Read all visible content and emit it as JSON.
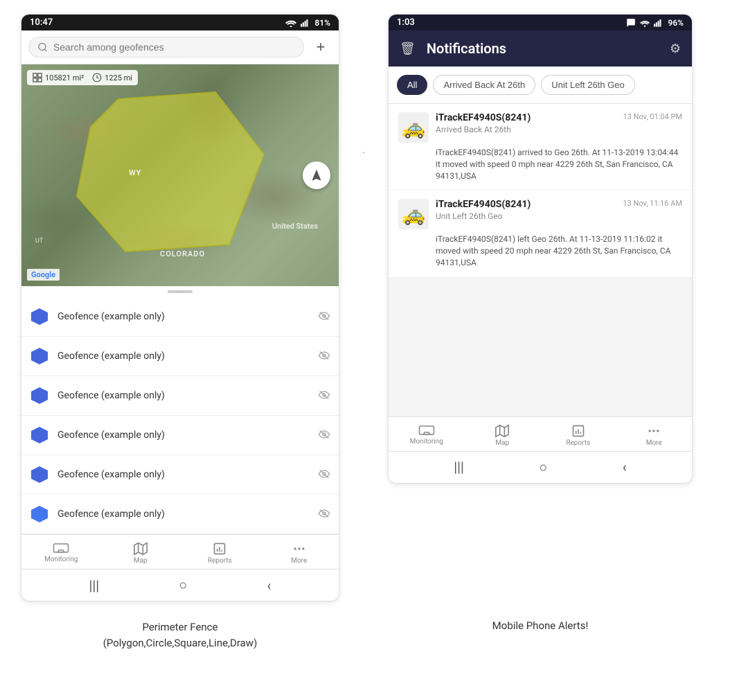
{
  "left_phone": {
    "status_bar": {
      "time": "10:47",
      "signal": "WiFi",
      "battery": "81%"
    },
    "search": {
      "placeholder": "Search among geofences"
    },
    "map": {
      "stat1": "105821 mi²",
      "stat2": "1225 mi",
      "labels": {
        "wy": "WY",
        "us": "United States",
        "co": "COLORADO",
        "ut": "UT"
      },
      "google": "Google"
    },
    "geo_items": [
      "Geofence (example only)",
      "Geofence (example only)",
      "Geofence (example only)",
      "Geofence (example only)",
      "Geofence (example only)",
      "Geofence (example only)"
    ],
    "bottom_nav": {
      "items": [
        "Monitoring",
        "Map",
        "Reports",
        "More"
      ]
    }
  },
  "right_phone": {
    "status_bar": {
      "time": "1:03",
      "battery": "96%"
    },
    "header": {
      "title": "Notifications",
      "delete_icon": "🗑",
      "settings_icon": "⚙"
    },
    "filter_tabs": [
      "All",
      "Arrived Back At 26th",
      "Unit Left 26th Geo"
    ],
    "notifications": [
      {
        "name": "iTrackEF4940S(8241)",
        "subtitle": "Arrived Back At 26th",
        "time": "13 Nov, 01:04 PM",
        "body": "iTrackEF4940S(8241) arrived to Geo 26th.   At 11-13-2019 13:04:44 it moved with speed 0 mph near 4229 26th St, San Francisco, CA 94131,USA"
      },
      {
        "name": "iTrackEF4940S(8241)",
        "subtitle": "Unit Left 26th Geo",
        "time": "13 Nov, 11:16 AM",
        "body": "iTrackEF4940S(8241) left Geo 26th.   At 11-13-2019 11:16:02 it moved with speed 20 mph near 4229 26th St, San Francisco, CA 94131,USA"
      }
    ],
    "bottom_nav": {
      "items": [
        "Monitoring",
        "Map",
        "Reports",
        "More"
      ]
    }
  },
  "captions": {
    "left": "Perimeter Fence\n(Polygon,Circle,Square,Line,Draw)",
    "right": "Mobile Phone Alerts!"
  }
}
